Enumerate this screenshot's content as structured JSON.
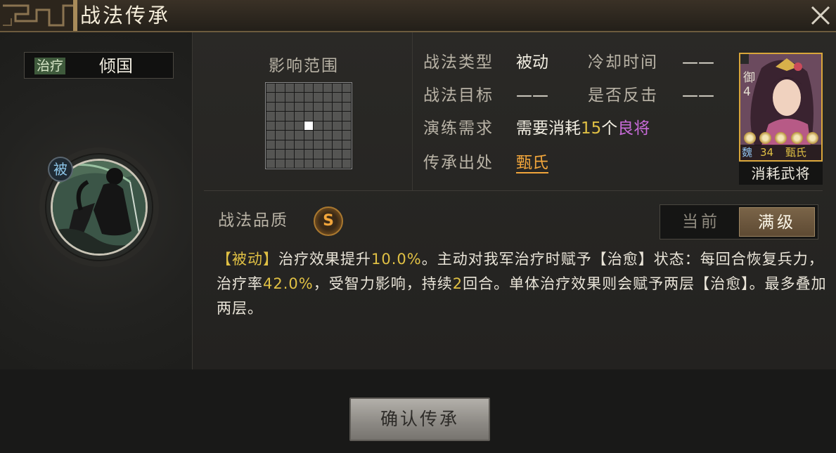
{
  "window": {
    "title": "战法传承",
    "close_icon": "close-icon"
  },
  "skill": {
    "type_tag": "治疗",
    "name": "倾国",
    "passive_badge": "被"
  },
  "range": {
    "label": "影响范围",
    "grid_size": 9,
    "center_cell": [
      4,
      4
    ]
  },
  "info": {
    "type_label": "战法类型",
    "type_value": "被动",
    "cooldown_label": "冷却时间",
    "cooldown_value": "——",
    "target_label": "战法目标",
    "target_value": "——",
    "counter_label": "是否反击",
    "counter_value": "——",
    "train_label": "演练需求",
    "train_prefix": "需要消耗",
    "train_count": "15",
    "train_unit": "个",
    "train_rank": "良将",
    "origin_label": "传承出处",
    "origin_value": "甄氏"
  },
  "card": {
    "level_prefix": "御",
    "level": "4",
    "stars": 5,
    "kingdom": "魏",
    "cost": "34",
    "name": "甄氏",
    "caption": "消耗武将"
  },
  "quality": {
    "label": "战法品质",
    "grade": "S"
  },
  "toggle": {
    "current": "当前",
    "max": "满级",
    "selected": "满级"
  },
  "description": {
    "p1_tag": "【被动】",
    "p1_a": "治疗效果提升",
    "p1_num1": "10.0%",
    "p1_b": "。主动对我军治疗时赋予【治愈】状态：每回合恢复兵力，治疗率",
    "p1_num2": "42.0%",
    "p1_c": "，受智力影响，持续",
    "p1_num3": "2",
    "p1_d": "回合。单体治疗效果则会赋予两层【治愈】。最多叠加两层。"
  },
  "confirm_button": "确认传承",
  "colors": {
    "highlight": "#e0c044",
    "rank_purple": "#c86bd9",
    "origin_orange": "#f1a53b",
    "type_tag_bg": "#3f5a3c"
  }
}
